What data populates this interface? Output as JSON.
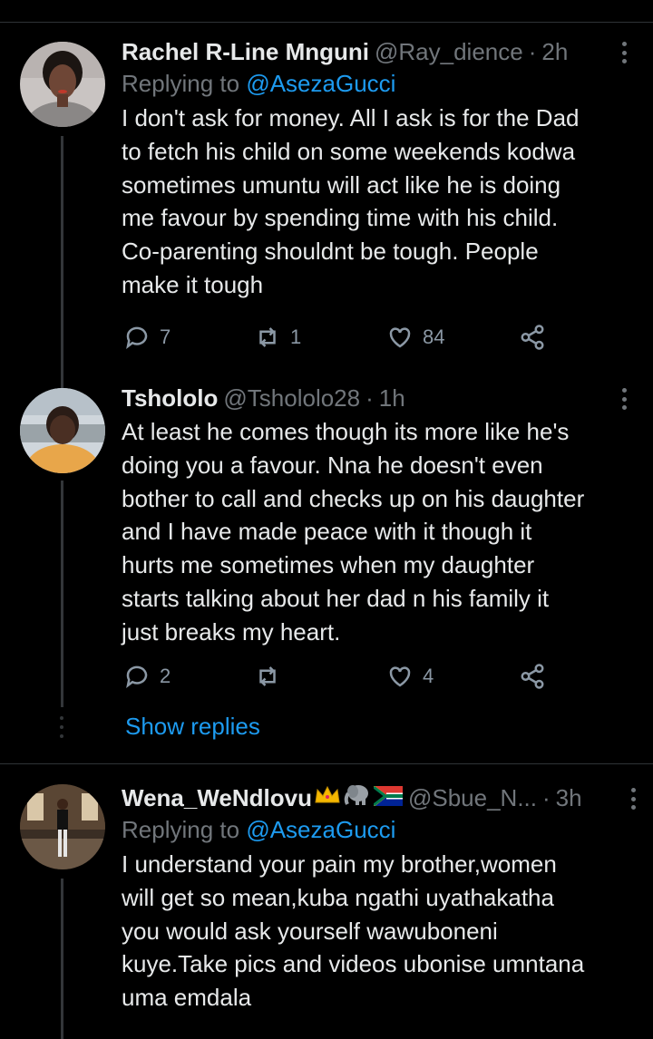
{
  "tweets": [
    {
      "display_name": "Rachel R-Line Mnguni",
      "handle": "@Ray_dience",
      "separator": "·",
      "time": "2h",
      "replying_prefix": "Replying to ",
      "replying_to": "@AsezaGucci",
      "lines": [
        "I don't ask for money. All I ask is for the Dad",
        "to fetch his child on some weekends kodwa",
        "sometimes umuntu will act like he is doing",
        "me favour by spending time with his child.",
        "Co-parenting shouldnt be tough. People",
        "make it tough"
      ],
      "replies": "7",
      "retweets": "1",
      "likes": "84"
    },
    {
      "display_name": "Tshololo",
      "handle": "@Tshololo28",
      "separator": "·",
      "time": "1h",
      "lines": [
        "At least he comes though its more like he's",
        "doing you a favour. Nna he doesn't even",
        "bother to call and checks up on his daughter",
        "and I have made peace with it though it",
        "hurts me sometimes when my daughter",
        "starts talking about her dad n his family it",
        "just breaks my heart."
      ],
      "replies": "2",
      "retweets": "",
      "likes": "4"
    },
    {
      "display_name": "Wena_WeNdlovu",
      "display_emojis": [
        "crown-emoji",
        "elephant-emoji",
        "south-africa-flag-emoji"
      ],
      "handle": "@Sbue_N...",
      "separator": "·",
      "time": "3h",
      "replying_prefix": "Replying to ",
      "replying_to": "@AsezaGucci",
      "lines": [
        "I understand your pain my brother,women",
        "will get so mean,kuba ngathi uyathakatha",
        "you would ask yourself wawuboneni",
        "kuye.Take pics and videos ubonise umntana",
        "uma emdala"
      ]
    }
  ],
  "show_replies": "Show replies",
  "colors": {
    "background": "#000000",
    "text": "#e7e9ea",
    "muted": "#71767b",
    "link": "#1d9bf0",
    "divider": "#2f3336"
  }
}
